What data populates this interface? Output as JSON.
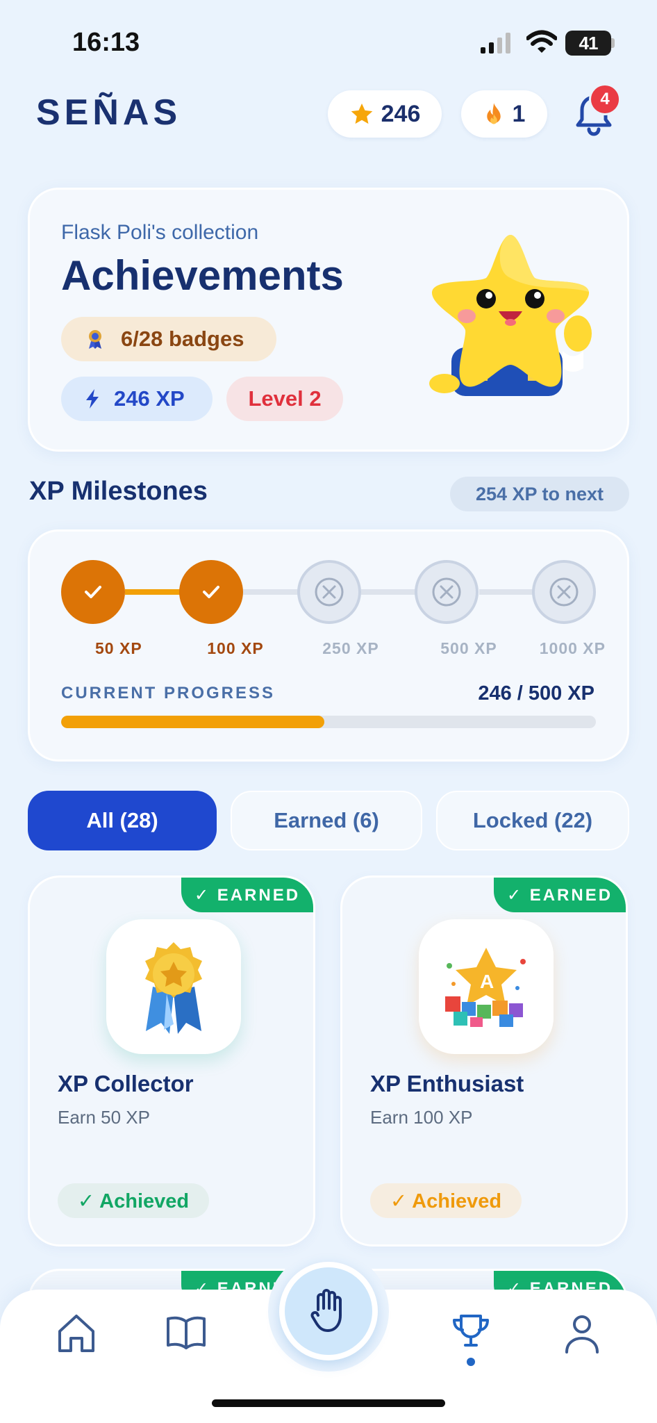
{
  "status_bar": {
    "time": "16:13",
    "battery": "41"
  },
  "header": {
    "logo": "SEÑAS",
    "stars": "246",
    "streak": "1",
    "notifications": "4"
  },
  "hero": {
    "subtitle": "Flask Poli's collection",
    "title": "Achievements",
    "badges": "6/28 badges",
    "xp": "246 XP",
    "level": "Level 2"
  },
  "milestones": {
    "title": "XP Milestones",
    "to_next": "254 XP to next",
    "items": [
      {
        "label": "50 XP",
        "achieved": true
      },
      {
        "label": "100 XP",
        "achieved": true
      },
      {
        "label": "250 XP",
        "achieved": false
      },
      {
        "label": "500 XP",
        "achieved": false
      },
      {
        "label": "1000 XP",
        "achieved": false
      }
    ],
    "progress_label": "CURRENT PROGRESS",
    "progress_value": "246 / 500 XP",
    "progress_fraction": 0.492
  },
  "tabs": [
    {
      "label": "All (28)",
      "active": true
    },
    {
      "label": "Earned (6)",
      "active": false
    },
    {
      "label": "Locked (22)",
      "active": false
    }
  ],
  "badges": [
    {
      "ribbon": "✓ EARNED",
      "title": "XP Collector",
      "description": "Earn 50 XP",
      "status": "✓ Achieved",
      "status_color": "#12a664",
      "icon": "medal-icon"
    },
    {
      "ribbon": "✓ EARNED",
      "title": "XP Enthusiast",
      "description": "Earn 100 XP",
      "status": "✓ Achieved",
      "status_color": "#ef9a0c",
      "icon": "star-blocks-icon"
    },
    {
      "ribbon": "✓ EARNED"
    },
    {
      "ribbon": "✓ EARNED"
    }
  ],
  "nav": [
    "home-icon",
    "book-icon",
    "hand-icon",
    "trophy-icon",
    "profile-icon"
  ],
  "colors": {
    "primary": "#1f48cf",
    "accent": "#dc7406",
    "earned": "#13b16c",
    "navy": "#17306f"
  }
}
